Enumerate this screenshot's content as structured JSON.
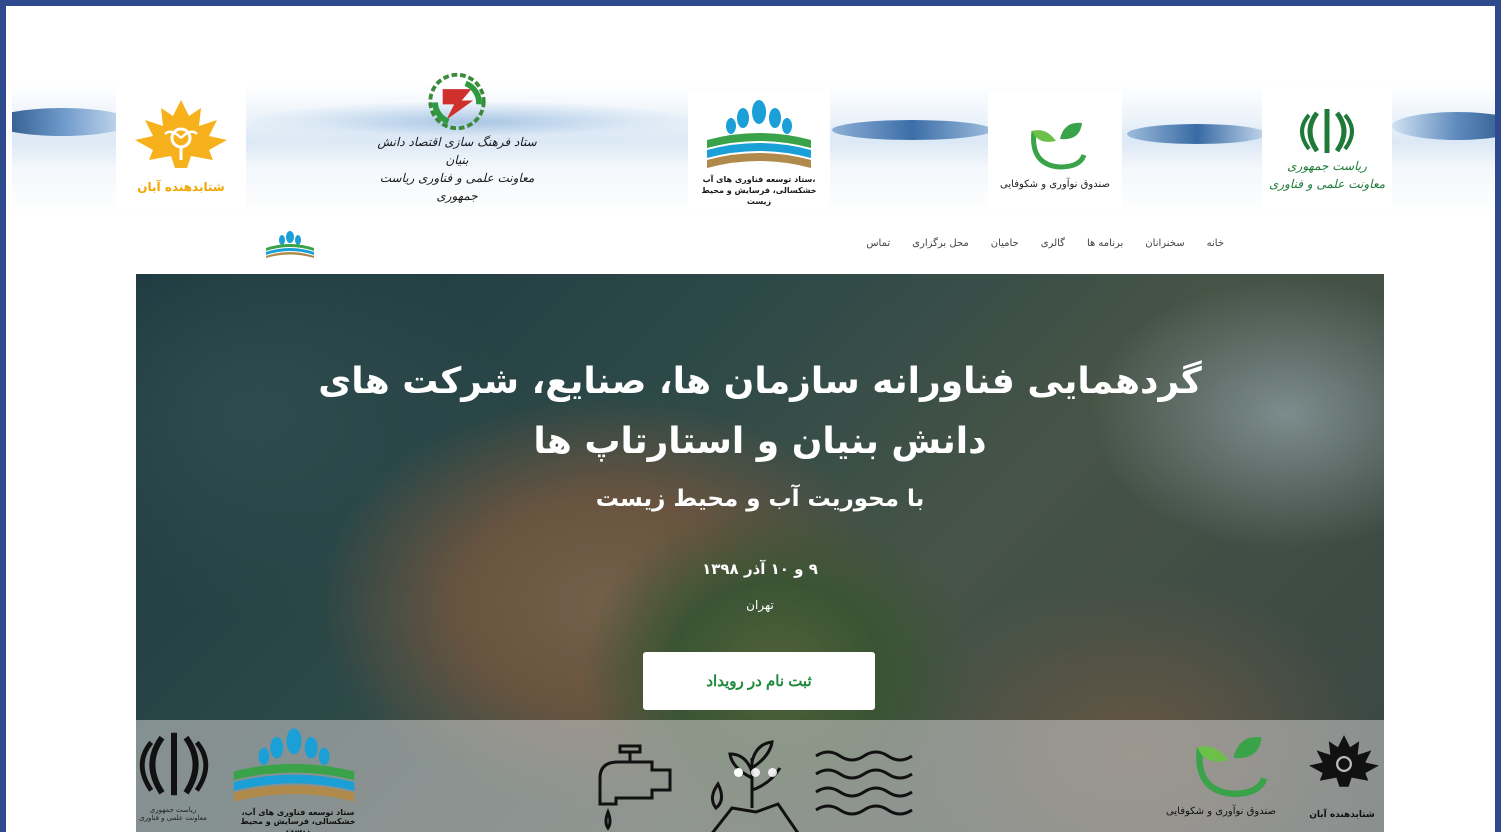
{
  "banner": {
    "logos": [
      {
        "name": "golden-leaf",
        "caption": "شتابدهنده آبان"
      },
      {
        "name": "staad",
        "caption_lines": [
          "ستاد فرهنگ سازی اقتصاد دانش بنیان",
          "معاونت علمی و فناوری ریاست جمهوری"
        ]
      },
      {
        "name": "water",
        "caption_lines": [
          "ستاد توسعه فناوری های آب،",
          "خشکسالی، فرسایش و محیط زیست"
        ]
      },
      {
        "name": "fund",
        "caption": "صندوق نوآوری و شکوفایی"
      },
      {
        "name": "presidency",
        "caption_lines": [
          "ریاست جمهوری",
          "معاونت علمی و فناوری"
        ]
      }
    ]
  },
  "nav": {
    "items": [
      "خانه",
      "سخنرانان",
      "برنامه ها",
      "گالری",
      "حامیان",
      "محل برگزاری",
      "تماس"
    ]
  },
  "hero": {
    "title": "گردهمایی فناورانه سازمان ها، صنایع، شرکت های دانش بنیان و استارتاپ ها",
    "subtitle": "با محوریت آب و محیط زیست",
    "date": "۹ و ۱۰ آذر ۱۳۹۸",
    "city": "تهران",
    "cta": "ثبت نام در رویداد",
    "strip_captions": {
      "presidency": "ریاست جمهوری معاونت علمی و فناوری",
      "water": "ستاد توسعه فناوری های آب، خشکسالی، فرسایش و محیط زیست",
      "fund": "صندوق نوآوری و شکوفایی",
      "golden": "شتابدهنده آبان"
    },
    "slider_dots": 3,
    "active_dot": 0
  },
  "colors": {
    "frame": "#2e4a8c",
    "cta_text": "#1f8a3c",
    "accent_green": "#1f7a3a",
    "golden": "#f0a500"
  }
}
